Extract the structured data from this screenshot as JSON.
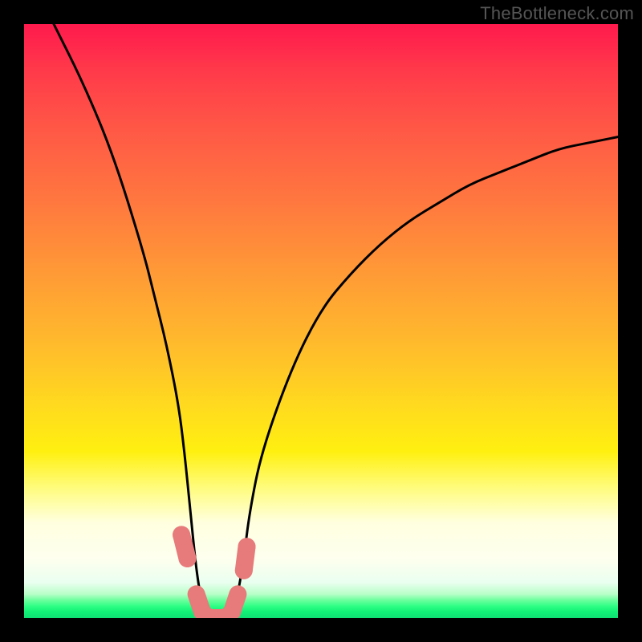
{
  "watermark": "TheBottleneck.com",
  "chart_data": {
    "type": "line",
    "title": "",
    "xlabel": "",
    "ylabel": "",
    "xlim": [
      0,
      100
    ],
    "ylim": [
      0,
      100
    ],
    "grid": false,
    "legend": false,
    "annotations": [],
    "series": [
      {
        "name": "valley-curve",
        "color": "#000000",
        "x": [
          5,
          10,
          15,
          20,
          22,
          24,
          26,
          27,
          28,
          29,
          30,
          31,
          32,
          33,
          34,
          35,
          36,
          37,
          38,
          40,
          45,
          50,
          55,
          60,
          65,
          70,
          75,
          80,
          85,
          90,
          95,
          100
        ],
        "y": [
          100,
          90,
          78,
          62,
          54,
          46,
          36,
          28,
          18,
          8,
          2,
          0,
          0,
          0,
          0,
          1,
          4,
          10,
          18,
          28,
          42,
          52,
          58,
          63,
          67,
          70,
          73,
          75,
          77,
          79,
          80,
          81
        ]
      },
      {
        "name": "pink-marker-strip",
        "color": "#e77a7a",
        "x": [
          26.5,
          27,
          27.5,
          29,
          30,
          31,
          32,
          33,
          34,
          35,
          36,
          37,
          37.5
        ],
        "y": [
          14,
          12,
          10,
          4,
          1,
          0,
          0,
          0,
          0,
          1,
          4,
          8,
          12
        ]
      }
    ]
  }
}
